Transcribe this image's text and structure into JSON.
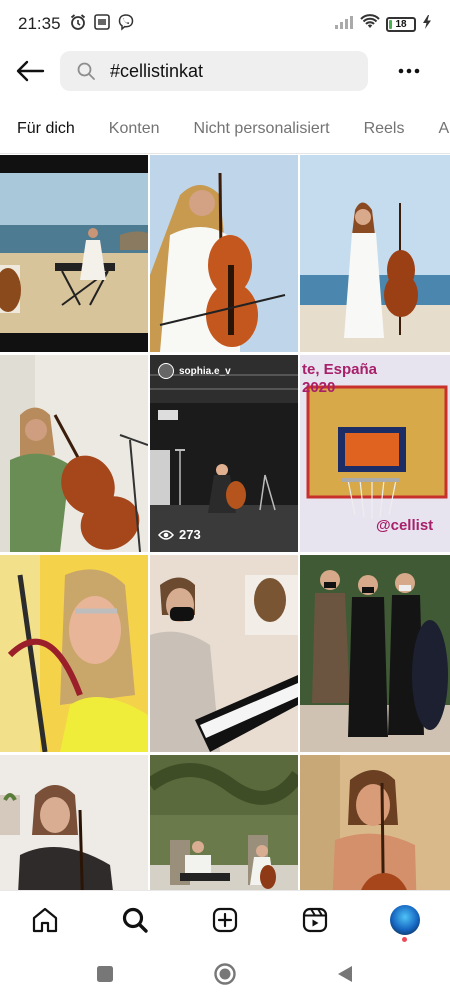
{
  "status_bar": {
    "time": "21:35",
    "battery_percent": "18",
    "battery_level": 0.18,
    "icons": [
      "alarm-icon",
      "photo-icon",
      "viber-icon",
      "signal-icon",
      "wifi-icon",
      "battery-icon",
      "charging-icon"
    ]
  },
  "search": {
    "query": "#cellistinkat"
  },
  "tabs": [
    {
      "label": "Für dich",
      "active": true
    },
    {
      "label": "Konten",
      "active": false
    },
    {
      "label": "Nicht personalisiert",
      "active": false
    },
    {
      "label": "Reels",
      "active": false
    },
    {
      "label": "A",
      "active": false
    }
  ],
  "grid": {
    "tiles": [
      {
        "name": "woman-at-keyboard-seaside"
      },
      {
        "name": "woman-in-white-with-cello"
      },
      {
        "name": "woman-standing-with-cello-beach"
      },
      {
        "name": "woman-playing-cello-indoors"
      },
      {
        "name": "stage-cello-performance",
        "handle": "sophia.e_v",
        "views": "273"
      },
      {
        "name": "poster-espana-2020",
        "text_line1": "te, España",
        "text_line2": "2020",
        "text_line3": "@cellist"
      },
      {
        "name": "smiling-woman-with-harp"
      },
      {
        "name": "masked-woman-at-piano"
      },
      {
        "name": "three-women-with-cello-case"
      },
      {
        "name": "woman-playing-cello-at-home"
      },
      {
        "name": "garden-concert"
      },
      {
        "name": "woman-with-cello-portrait"
      }
    ]
  },
  "bottom_nav": {
    "items": [
      "home-icon",
      "search-icon",
      "create-post-icon",
      "reels-icon",
      "profile-avatar"
    ]
  },
  "system_nav": {
    "items": [
      "recents-square-icon",
      "home-circle-icon",
      "back-triangle-icon"
    ]
  },
  "colors": {
    "notification_dot": "#ed4956",
    "battery_fill": "#4caf50",
    "poster_text": "#a8206a"
  }
}
